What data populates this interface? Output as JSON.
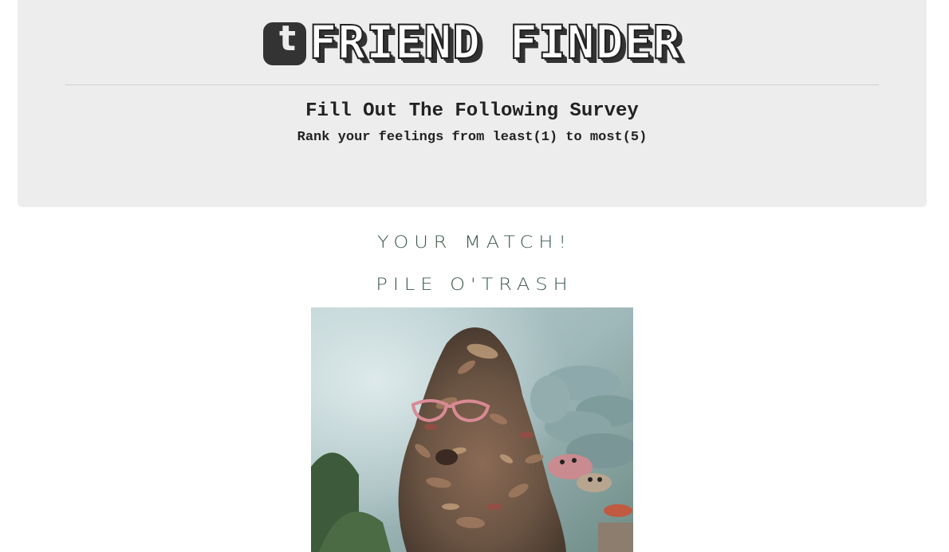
{
  "header": {
    "logo_glyph": "t",
    "logo_icon": "tumblr-t-icon",
    "title": "FRIEND FINDER"
  },
  "survey": {
    "title": "Fill Out The Following Survey",
    "subtitle": "Rank your feelings from least(1) to most(5)"
  },
  "result": {
    "heading": "YOUR MATCH!",
    "name": "PILE O'TRASH"
  },
  "colors": {
    "jumbotron_bg": "#ededed",
    "match_text": "#3d5a4a",
    "heading_text": "#222222"
  }
}
